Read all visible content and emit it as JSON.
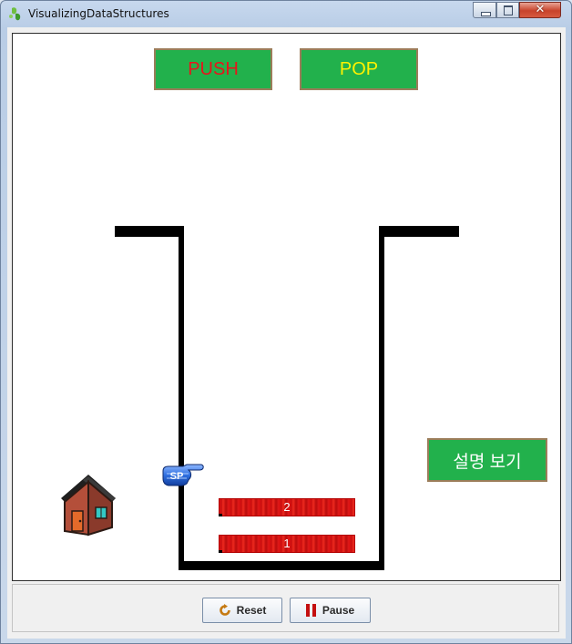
{
  "window": {
    "title": "VisualizingDataStructures",
    "controls": [
      "minimize-icon",
      "maximize-icon",
      "close-icon"
    ],
    "close_glyph": "✕"
  },
  "canvas": {
    "push_label": "PUSH",
    "pop_label": "POP",
    "explain_label": "설명 보기",
    "pointer_label": "SP",
    "stack_items": [
      "2",
      "1"
    ],
    "colors": {
      "button_bg": "#22b14c",
      "push_text": "#e8141c",
      "pop_text": "#fff200",
      "stack_item": "#e31414"
    },
    "icons": [
      "house-icon",
      "hand-pointer-icon"
    ]
  },
  "toolbar": {
    "reset_label": "Reset",
    "pause_label": "Pause",
    "reset_icon": "reset-icon",
    "pause_icon": "pause-icon"
  }
}
